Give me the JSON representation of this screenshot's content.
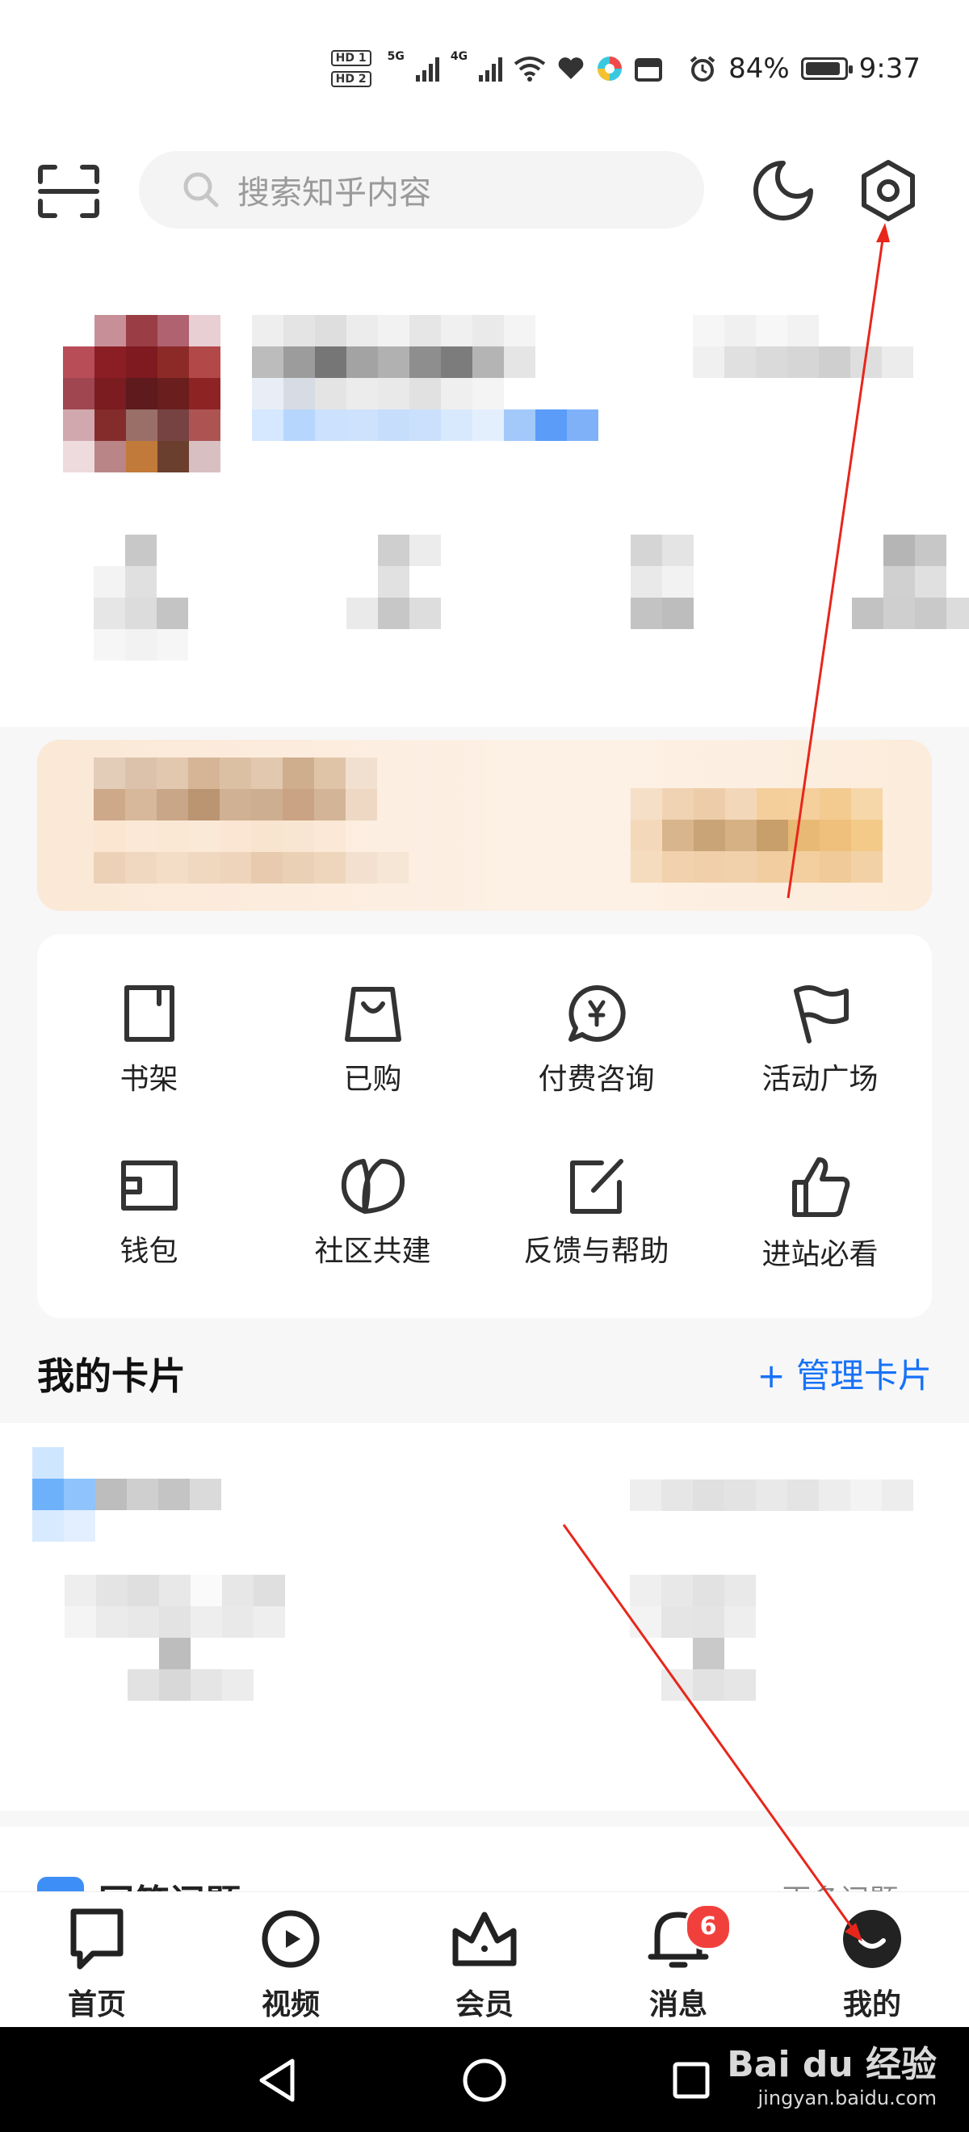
{
  "status_bar": {
    "hd1": "HD 1",
    "hd2": "HD 2",
    "net1": "5G",
    "net2": "4G",
    "battery": "84%",
    "time": "9:37"
  },
  "header": {
    "search_placeholder": "搜索知乎内容",
    "scan_icon": "scan-icon",
    "night_icon": "moon-icon",
    "settings_icon": "settings-gear-icon"
  },
  "features": [
    {
      "label": "书架",
      "icon": "bookshelf-icon"
    },
    {
      "label": "已购",
      "icon": "shopping-bag-icon"
    },
    {
      "label": "付费咨询",
      "icon": "paid-consult-icon"
    },
    {
      "label": "活动广场",
      "icon": "flag-icon"
    },
    {
      "label": "钱包",
      "icon": "wallet-icon"
    },
    {
      "label": "社区共建",
      "icon": "community-icon"
    },
    {
      "label": "反馈与帮助",
      "icon": "feedback-edit-icon"
    },
    {
      "label": "进站必看",
      "icon": "thumbs-up-icon"
    }
  ],
  "cards_section": {
    "title": "我的卡片",
    "manage": "+ 管理卡片"
  },
  "qa_card": {
    "title": "回答问题",
    "more": "更多问题 >"
  },
  "tabbar": [
    {
      "label": "首页",
      "icon": "home-comment-icon"
    },
    {
      "label": "视频",
      "icon": "video-play-icon"
    },
    {
      "label": "会员",
      "icon": "crown-icon"
    },
    {
      "label": "消息",
      "icon": "bell-icon",
      "badge": "6"
    },
    {
      "label": "我的",
      "icon": "profile-avatar-icon"
    }
  ],
  "watermark": {
    "brand": "Bai du 经验",
    "url": "jingyan.baidu.com"
  },
  "colors": {
    "accent": "#1772f6",
    "badge": "#f1403c",
    "annotation_arrow": "#e8261b"
  }
}
